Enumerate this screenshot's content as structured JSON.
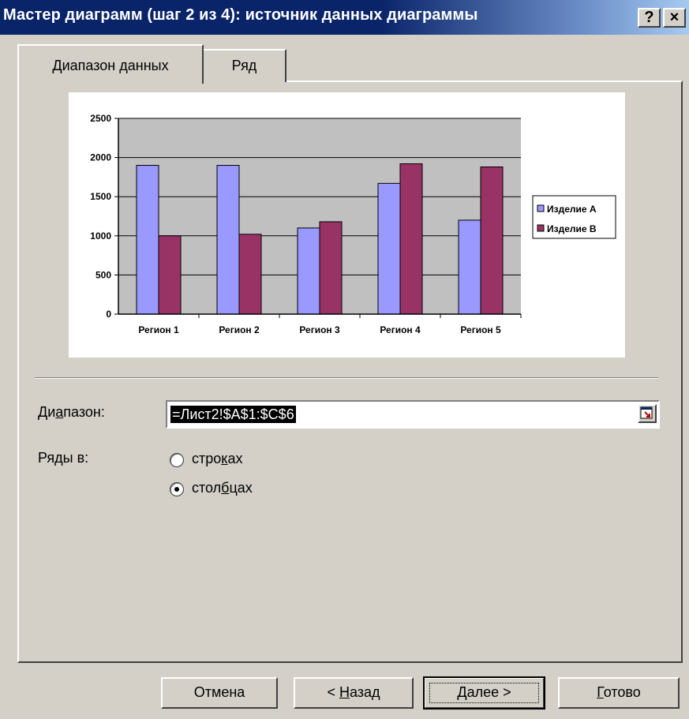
{
  "window": {
    "title": "Мастер диаграмм (шаг 2 из 4): источник данных диаграммы",
    "help_glyph": "?",
    "close_glyph": "×"
  },
  "tabs": [
    {
      "label": "Диапазон данных",
      "active": true
    },
    {
      "label": "Ряд",
      "active": false
    }
  ],
  "chart_data": {
    "type": "bar",
    "categories": [
      "Регион 1",
      "Регион 2",
      "Регион 3",
      "Регион 4",
      "Регион 5"
    ],
    "series": [
      {
        "name": "Изделие A",
        "color": "#9999ff",
        "values": [
          1900,
          1900,
          1100,
          1670,
          1200
        ]
      },
      {
        "name": "Изделие B",
        "color": "#993366",
        "values": [
          1000,
          1020,
          1180,
          1920,
          1880
        ]
      }
    ],
    "ylim": [
      0,
      2500
    ],
    "yticks": [
      "0",
      "500",
      "1000",
      "1500",
      "2000",
      "2500"
    ],
    "grid": true,
    "legend": "right"
  },
  "range": {
    "label_pre": "Ди",
    "label_u": "а",
    "label_post": "пазон:",
    "value": "=Лист2!$A$1:$C$6"
  },
  "series_in": {
    "label": "Ряды в:",
    "options": [
      {
        "pre": "стро",
        "u": "к",
        "post": "ах",
        "selected": false
      },
      {
        "pre": "стол",
        "u": "б",
        "post": "цах",
        "selected": true
      }
    ]
  },
  "buttons": {
    "cancel": "Отмена",
    "back": {
      "pre": "< ",
      "u": "Н",
      "post": "азад"
    },
    "next": {
      "pre": "",
      "u": "Д",
      "post": "алее >"
    },
    "finish": {
      "pre": "",
      "u": "Г",
      "post": "отово"
    }
  }
}
